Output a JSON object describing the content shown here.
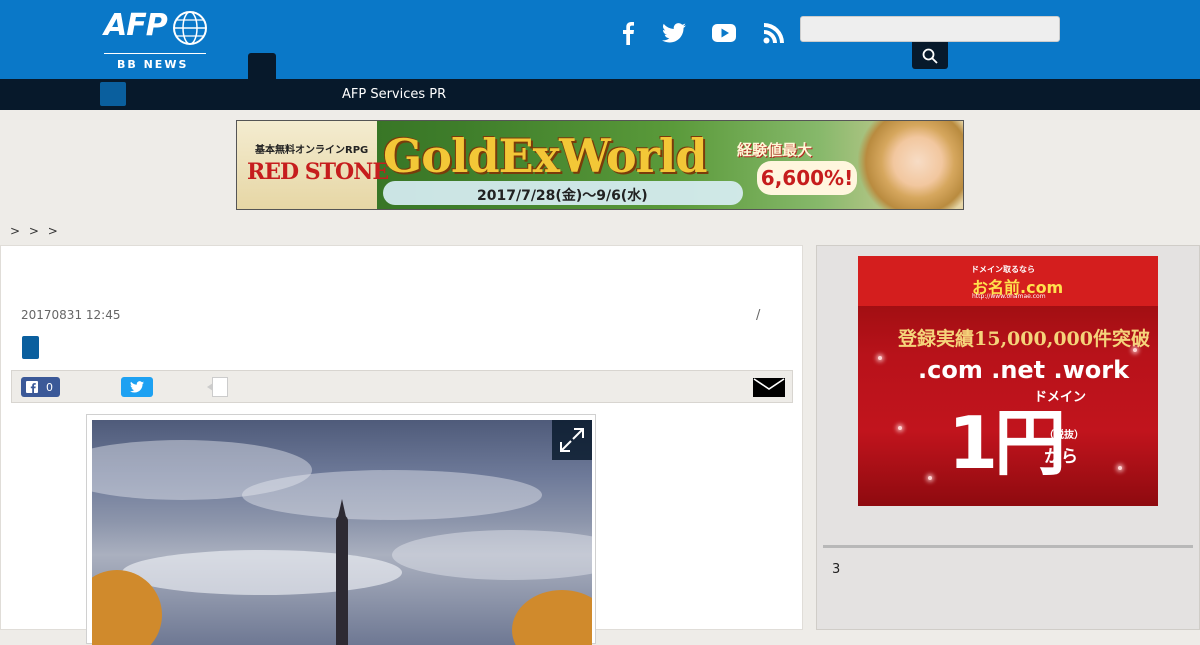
{
  "header": {
    "logo_text": "AFP",
    "logo_subtext": "BB NEWS",
    "search_placeholder": "",
    "colors": {
      "brand_blue": "#0a78c8",
      "navy": "#07192b"
    },
    "social_icons": [
      "facebook-icon",
      "twitter-icon",
      "youtube-icon",
      "rss-icon"
    ]
  },
  "nav": {
    "link": "AFP Services PR"
  },
  "banner": {
    "small_text": "基本無料オンラインRPG",
    "brand": "RED STONE",
    "title": "GoldExWorld",
    "date": "2017/7/28(金)～9/6(水)",
    "badge": "経験値最大",
    "bonus": "6,600%!"
  },
  "breadcrumb": ">  >  >",
  "article": {
    "timestamp": "20170831 12:45",
    "separator": "/",
    "share": {
      "facebook_count": "0"
    }
  },
  "sidebar": {
    "ad": {
      "small": "ドメイン取るなら",
      "brand": "お名前.com",
      "url": "http://www.onamae.com",
      "line1": "登録実績15,000,000件突破",
      "line2": ".com .net .work",
      "line3": "ドメイン",
      "line4": "1円",
      "line5": "（税抜）",
      "line6": "から"
    },
    "heading": "3"
  }
}
